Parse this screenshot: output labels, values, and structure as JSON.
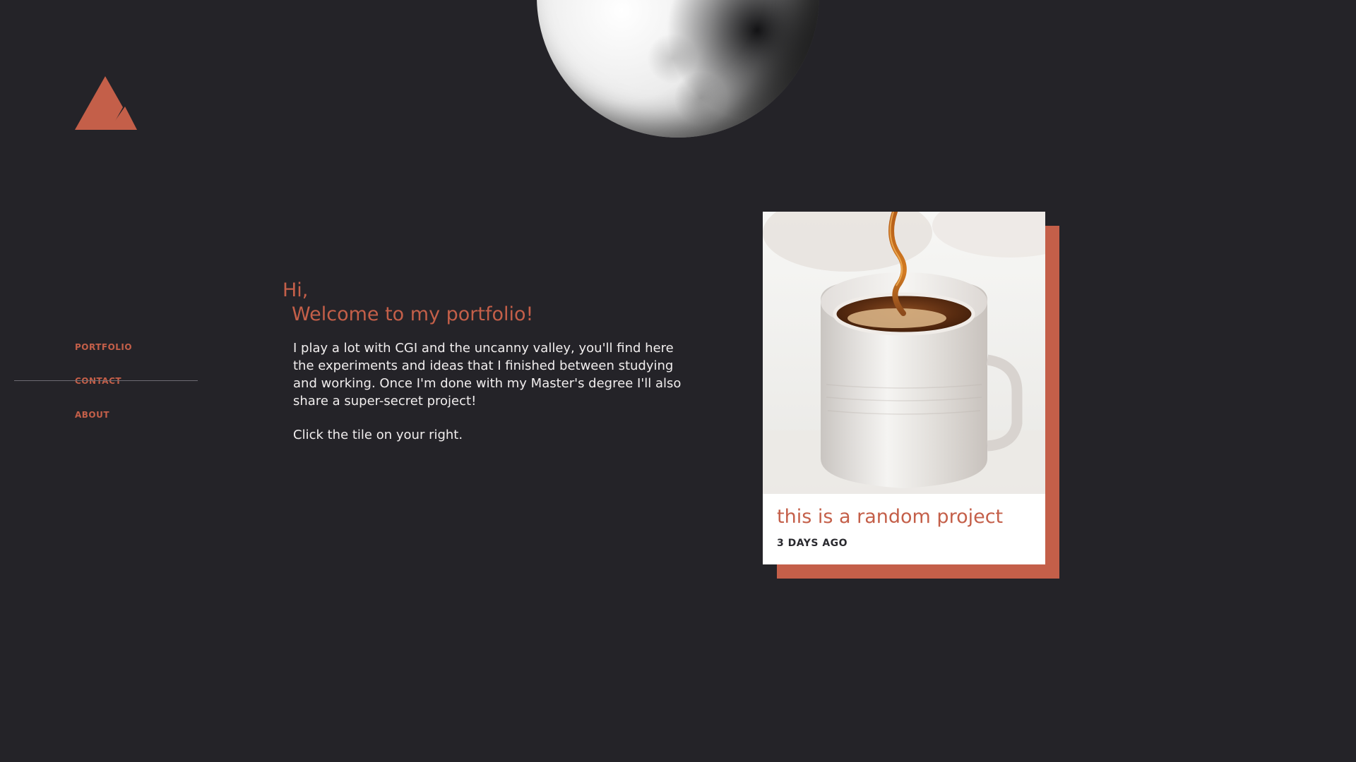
{
  "nav": {
    "items": [
      {
        "label": "PORTFOLIO"
      },
      {
        "label": "CONTACT"
      },
      {
        "label": "ABOUT"
      }
    ]
  },
  "intro": {
    "greeting": "Hi,",
    "title": "Welcome to my portfolio!",
    "body": "I play a lot with CGI and the uncanny valley, you'll find here the experiments and ideas that I finished between studying and working. Once I'm done with my Master's degree I'll also share a super-secret project!",
    "cta": "Click the tile on your right."
  },
  "card": {
    "title": "this is a random project",
    "meta": "3 DAYS AGO",
    "image_subject": "coffee pouring into a white cup"
  },
  "colors": {
    "background": "#242328",
    "accent": "#c45f49",
    "text": "#f1eeee",
    "card": "#ffffff"
  },
  "icons": {
    "logo": "triangle-logo-icon"
  }
}
